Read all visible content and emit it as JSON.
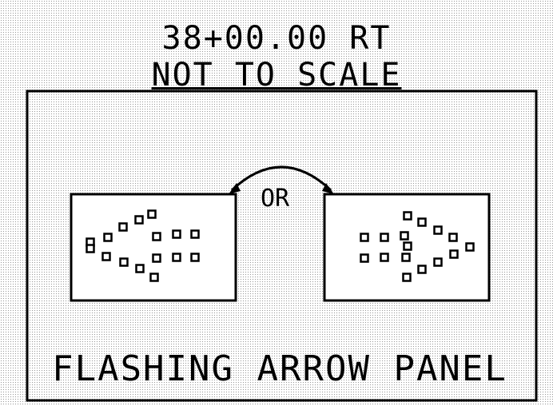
{
  "header": {
    "station": "38+00.00 RT",
    "scale_note": "NOT TO SCALE"
  },
  "diagram": {
    "or_label": "OR",
    "caption": "FLASHING ARROW PANEL",
    "left_panel": {
      "arrow_direction": "left"
    },
    "right_panel": {
      "arrow_direction": "right"
    }
  }
}
